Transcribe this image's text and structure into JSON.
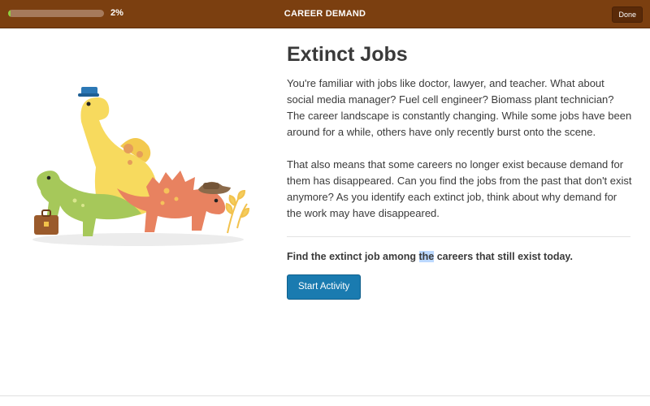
{
  "header": {
    "progress_percent": 2,
    "progress_label": "2%",
    "title": "CAREER DEMAND",
    "done_label": "Done"
  },
  "main": {
    "heading": "Extinct Jobs",
    "paragraphs": [
      "You're familiar with jobs like doctor, lawyer, and teacher. What about social media manager? Fuel cell engineer? Biomass plant technician? The career landscape is constantly changing. While some jobs have been around for a while, others have only recently burst onto the scene.",
      "That also means that some careers no longer exist because demand for them has disappeared. Can you find the jobs from the past that don't exist anymore? As you identify each extinct job, think about why demand for the work may have disappeared."
    ],
    "instruction": {
      "before": "Find the extinct job among ",
      "highlight": "the",
      "after": " careers that still exist today."
    },
    "start_label": "Start Activity"
  },
  "colors": {
    "topbar": "#7b3f10",
    "progress_fill": "#8fcf3f",
    "accent_button": "#1a7bb0"
  }
}
